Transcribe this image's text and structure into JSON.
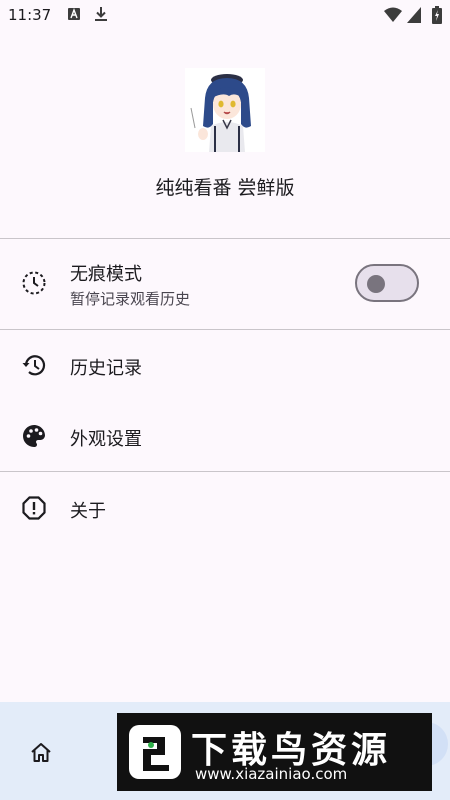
{
  "status_bar": {
    "time": "11:37",
    "icons": [
      "a-notification-icon",
      "download-icon",
      "wifi-icon",
      "signal-icon",
      "battery-icon"
    ]
  },
  "header": {
    "app_title": "纯纯看番 尝鲜版",
    "avatar_icon": "anime-avatar"
  },
  "settings": {
    "incognito": {
      "title": "无痕模式",
      "subtitle": "暂停记录观看历史",
      "icon": "incognito-timer-icon",
      "enabled": false
    },
    "items": [
      {
        "label": "历史记录",
        "icon": "history-icon"
      },
      {
        "label": "外观设置",
        "icon": "palette-icon"
      },
      {
        "label": "关于",
        "icon": "info-octagon-icon"
      }
    ]
  },
  "bottom_nav": {
    "icon": "home-icon"
  },
  "watermark": {
    "title": "下载鸟资源",
    "url": "www.xiazainiao.com"
  },
  "colors": {
    "background": "#fdf8fd",
    "text": "#1c1b1f",
    "subtext": "#49454f",
    "divider": "#c9c5ca",
    "toggle_off": "#79747e",
    "bottom_nav": "#e3ecf9"
  }
}
